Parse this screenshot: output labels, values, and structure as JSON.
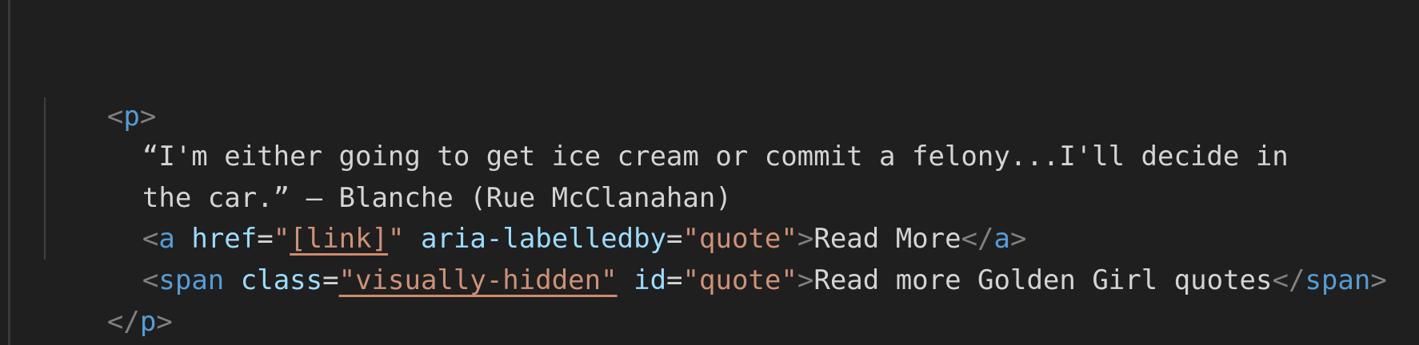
{
  "code": {
    "line1": {
      "open": "<",
      "tag": "p",
      "close": ">"
    },
    "line2": {
      "text": "“I'm either going to get ice cream or commit a felony...I'll decide in"
    },
    "line3": {
      "text": "the car.” — Blanche (Rue McClanahan)"
    },
    "line4": {
      "lt": "<",
      "tag": "a",
      "attr1": "href",
      "eq": "=",
      "q": "\"",
      "val1": "[link]",
      "attr2": "aria-labelledby",
      "val2": "quote",
      "gt": ">",
      "content": "Read More",
      "close_open": "</",
      "close_tag": "a",
      "close_gt": ">"
    },
    "line5": {
      "lt": "<",
      "tag": "span",
      "attr1": "class",
      "eq": "=",
      "q": "\"",
      "val1": "visually-hidden",
      "attr2": "id",
      "val2": "quote",
      "gt": ">",
      "content": "Read more Golden Girl quotes",
      "close_open": "</",
      "close_tag": "span",
      "close_gt": ">"
    },
    "line6": {
      "open": "</",
      "tag": "p",
      "close": ">"
    }
  },
  "colors": {
    "background": "#1f1f1f",
    "tag": "#569cd6",
    "attribute": "#9cdcfe",
    "string": "#ce9178",
    "punctuation": "#808080",
    "text": "#d4d4d4"
  }
}
